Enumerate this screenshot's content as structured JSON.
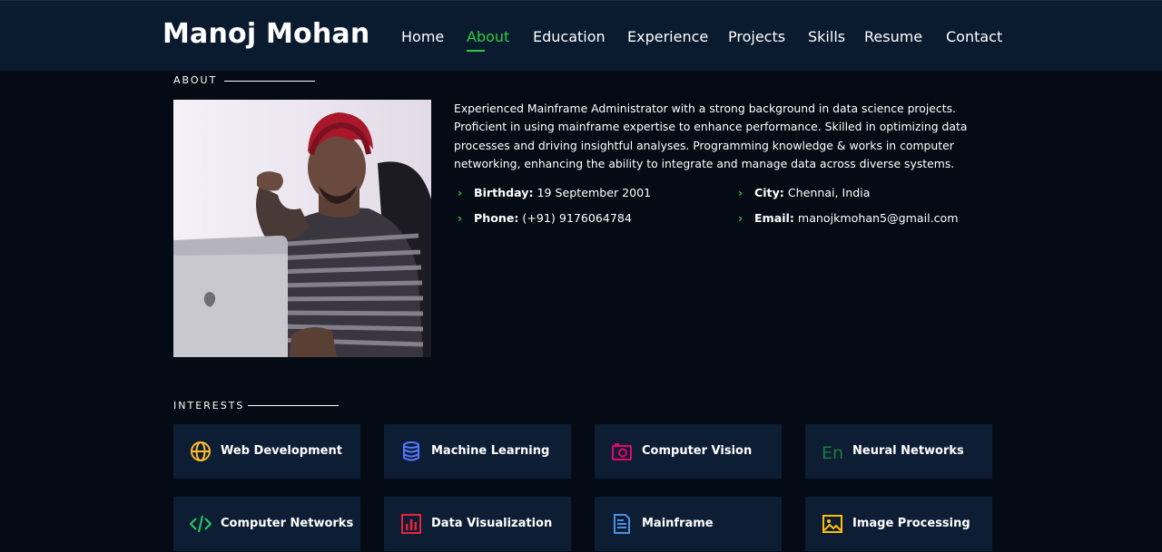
{
  "header": {
    "logo": "Manoj Mohan",
    "nav": [
      {
        "label": "Home",
        "active": false
      },
      {
        "label": "About",
        "active": true
      },
      {
        "label": "Education",
        "active": false
      },
      {
        "label": "Experience",
        "active": false
      },
      {
        "label": "Projects",
        "active": false
      },
      {
        "label": "Skills",
        "active": false
      },
      {
        "label": "Resume",
        "active": false
      },
      {
        "label": "Contact",
        "active": false
      }
    ]
  },
  "about": {
    "title": "ABOUT",
    "description": "Experienced Mainframe Administrator with a strong background in data science projects. Proficient in using mainframe expertise to enhance performance. Skilled in optimizing data processes and driving insightful analyses. Programming knowledge & works in computer networking, enhancing the ability to integrate and manage data across diverse systems.",
    "details": {
      "birthday_label": "Birthday:",
      "birthday": "19 September 2001",
      "phone_label": "Phone:",
      "phone": "(+91) 9176064784",
      "city_label": "City:",
      "city": "Chennai, India",
      "email_label": "Email:",
      "email": "manojkmohan5@gmail.com"
    }
  },
  "interests": {
    "title": "INTERESTS",
    "items": [
      {
        "label": "Web Development",
        "icon": "globe-icon",
        "color": "#ffbb2c"
      },
      {
        "label": "Machine Learning",
        "icon": "database-icon",
        "color": "#5578ff"
      },
      {
        "label": "Computer Vision",
        "icon": "camera-icon",
        "color": "#e80368"
      },
      {
        "label": "Neural Networks",
        "icon": "language-en-icon",
        "color": "#1c7c3c"
      },
      {
        "label": "Computer Networks",
        "icon": "code-slash-icon",
        "color": "#29cc61"
      },
      {
        "label": "Data Visualization",
        "icon": "bar-chart-icon",
        "color": "#e7223b"
      },
      {
        "label": "Mainframe",
        "icon": "document-icon",
        "color": "#4a90e2"
      },
      {
        "label": "Image Processing",
        "icon": "image-icon",
        "color": "#ffc107"
      }
    ]
  }
}
